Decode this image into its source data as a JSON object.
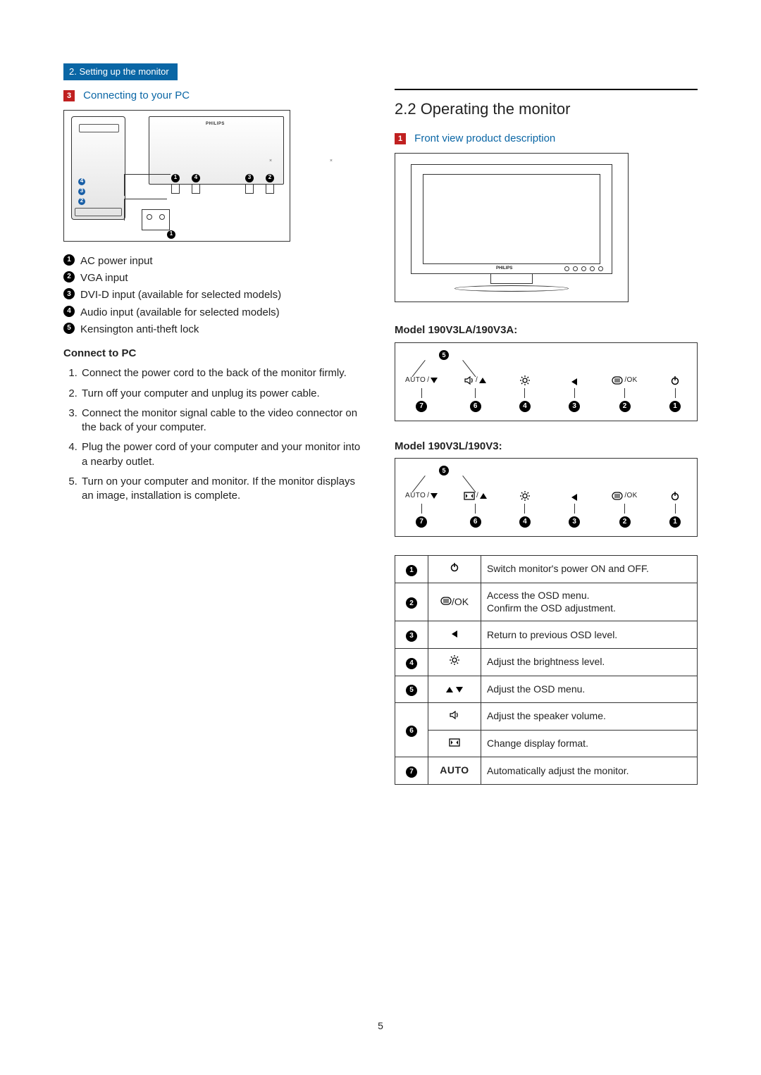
{
  "chapter_tab": "2. Setting up the monitor",
  "page_number": "5",
  "left": {
    "step_badge": "3",
    "step_title": "Connecting to your PC",
    "diagram_logo": "PHILIPS",
    "conn_callouts": {
      "pc": [
        {
          "n": "4",
          "color": "blue"
        },
        {
          "n": "3",
          "color": "blue"
        },
        {
          "n": "2",
          "color": "blue"
        }
      ],
      "mon": [
        {
          "n": "1",
          "color": "black"
        },
        {
          "n": "4",
          "color": "black"
        },
        {
          "n": "3",
          "color": "black"
        },
        {
          "n": "2",
          "color": "black"
        }
      ],
      "socket": {
        "n": "1",
        "color": "black"
      }
    },
    "legend": [
      {
        "n": "1",
        "text": "AC power input"
      },
      {
        "n": "2",
        "text": "VGA input"
      },
      {
        "n": "3",
        "text": "DVI-D input (available for selected models)"
      },
      {
        "n": "4",
        "text": "Audio input (available for selected models)"
      },
      {
        "n": "5",
        "text": "Kensington anti-theft lock"
      }
    ],
    "connect_head": "Connect to PC",
    "connect_steps": [
      "Connect the power cord to the back of the monitor firmly.",
      "Turn off your computer and unplug its power cable.",
      "Connect the monitor signal cable to the video connector on the back of your computer.",
      "Plug the power cord of your computer and your monitor into a nearby outlet.",
      "Turn on your computer and monitor. If the monitor displays an image,  installation is complete."
    ]
  },
  "right": {
    "heading": "2.2  Operating the monitor",
    "step_badge": "1",
    "step_title": "Front view product description",
    "diagram_logo": "PHILIPS",
    "variants": [
      {
        "label": "Model 190V3LA/190V3A:",
        "five": "5",
        "buttons": [
          {
            "n": "7",
            "label_left": "AUTO",
            "icon_right": "tri-d"
          },
          {
            "n": "6",
            "icon_left": "speaker",
            "icon_right": "tri-u"
          },
          {
            "n": "4",
            "icon_left": "bright"
          },
          {
            "n": "3",
            "icon_left": "tri-l"
          },
          {
            "n": "2",
            "icon_left": "menu",
            "label_right": "/OK"
          },
          {
            "n": "1",
            "icon_left": "power"
          }
        ]
      },
      {
        "label": "Model 190V3L/190V3:",
        "five": "5",
        "buttons": [
          {
            "n": "7",
            "label_left": "AUTO",
            "icon_right": "tri-d"
          },
          {
            "n": "6",
            "icon_left": "aspect",
            "icon_right": "tri-u"
          },
          {
            "n": "4",
            "icon_left": "bright"
          },
          {
            "n": "3",
            "icon_left": "tri-l"
          },
          {
            "n": "2",
            "icon_left": "menu",
            "label_right": "/OK"
          },
          {
            "n": "1",
            "icon_left": "power"
          }
        ]
      }
    ],
    "func_table": [
      {
        "n": "1",
        "icon": "power",
        "desc": "Switch monitor's power ON and OFF."
      },
      {
        "n": "2",
        "icon": "menu-ok",
        "desc": "Access the OSD menu.\nConfirm the OSD adjustment."
      },
      {
        "n": "3",
        "icon": "tri-l",
        "desc": "Return to previous OSD level."
      },
      {
        "n": "4",
        "icon": "bright",
        "desc": "Adjust the brightness level."
      },
      {
        "n": "5",
        "icon": "updown",
        "desc": "Adjust the OSD menu."
      },
      {
        "n": "6a",
        "icon": "speaker",
        "desc": "Adjust the speaker volume.",
        "rowspan_for_6": true
      },
      {
        "n": "6b",
        "icon": "aspect",
        "desc": "Change display format."
      },
      {
        "n": "7",
        "icon": "auto",
        "desc": "Automatically adjust the monitor."
      }
    ]
  }
}
